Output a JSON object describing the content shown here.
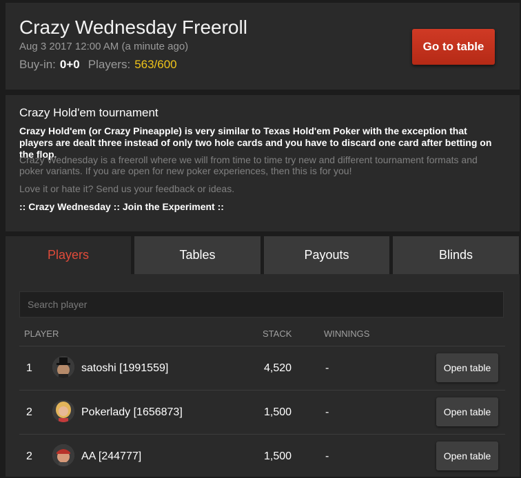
{
  "header": {
    "title": "Crazy Wednesday Freeroll",
    "date": "Aug 3 2017 12:00 AM (a minute ago)",
    "buyin_label": "Buy-in:",
    "buyin_value": "0+0",
    "players_label": "Players:",
    "players_value": "563/600",
    "goto_button": "Go to table"
  },
  "description": {
    "title": "Crazy Hold'em tournament",
    "bold_text": "Crazy Hold'em (or Crazy Pineapple) is very similar to Texas Hold'em Poker with the exception that players are dealt three instead of only two hole cards and you have to discard one card after betting on the flop.",
    "grey_text_1": "Crazy Wednesday is a freeroll where we will from time to time try new and different tournament formats and poker variants. If you are open for new poker experiences, then this is for you!",
    "grey_text_2": "Love it or hate it? Send us your feedback or ideas.",
    "tagline": ":: Crazy Wednesday :: Join the Experiment ::"
  },
  "tabs": [
    "Players",
    "Tables",
    "Payouts",
    "Blinds"
  ],
  "players": {
    "search_placeholder": "Search player",
    "columns": {
      "player": "PLAYER",
      "stack": "STACK",
      "winnings": "WINNINGS"
    },
    "rows": [
      {
        "rank": "1",
        "name": "satoshi [1991559]",
        "stack": "4,520",
        "winnings": "-",
        "action": "Open table"
      },
      {
        "rank": "2",
        "name": "Pokerlady [1656873]",
        "stack": "1,500",
        "winnings": "-",
        "action": "Open table"
      },
      {
        "rank": "2",
        "name": "AA [244777]",
        "stack": "1,500",
        "winnings": "-",
        "action": "Open table"
      }
    ]
  },
  "colors": {
    "accent_red": "#c8321e",
    "gold": "#f0c419",
    "active_tab": "#e04b3a"
  }
}
